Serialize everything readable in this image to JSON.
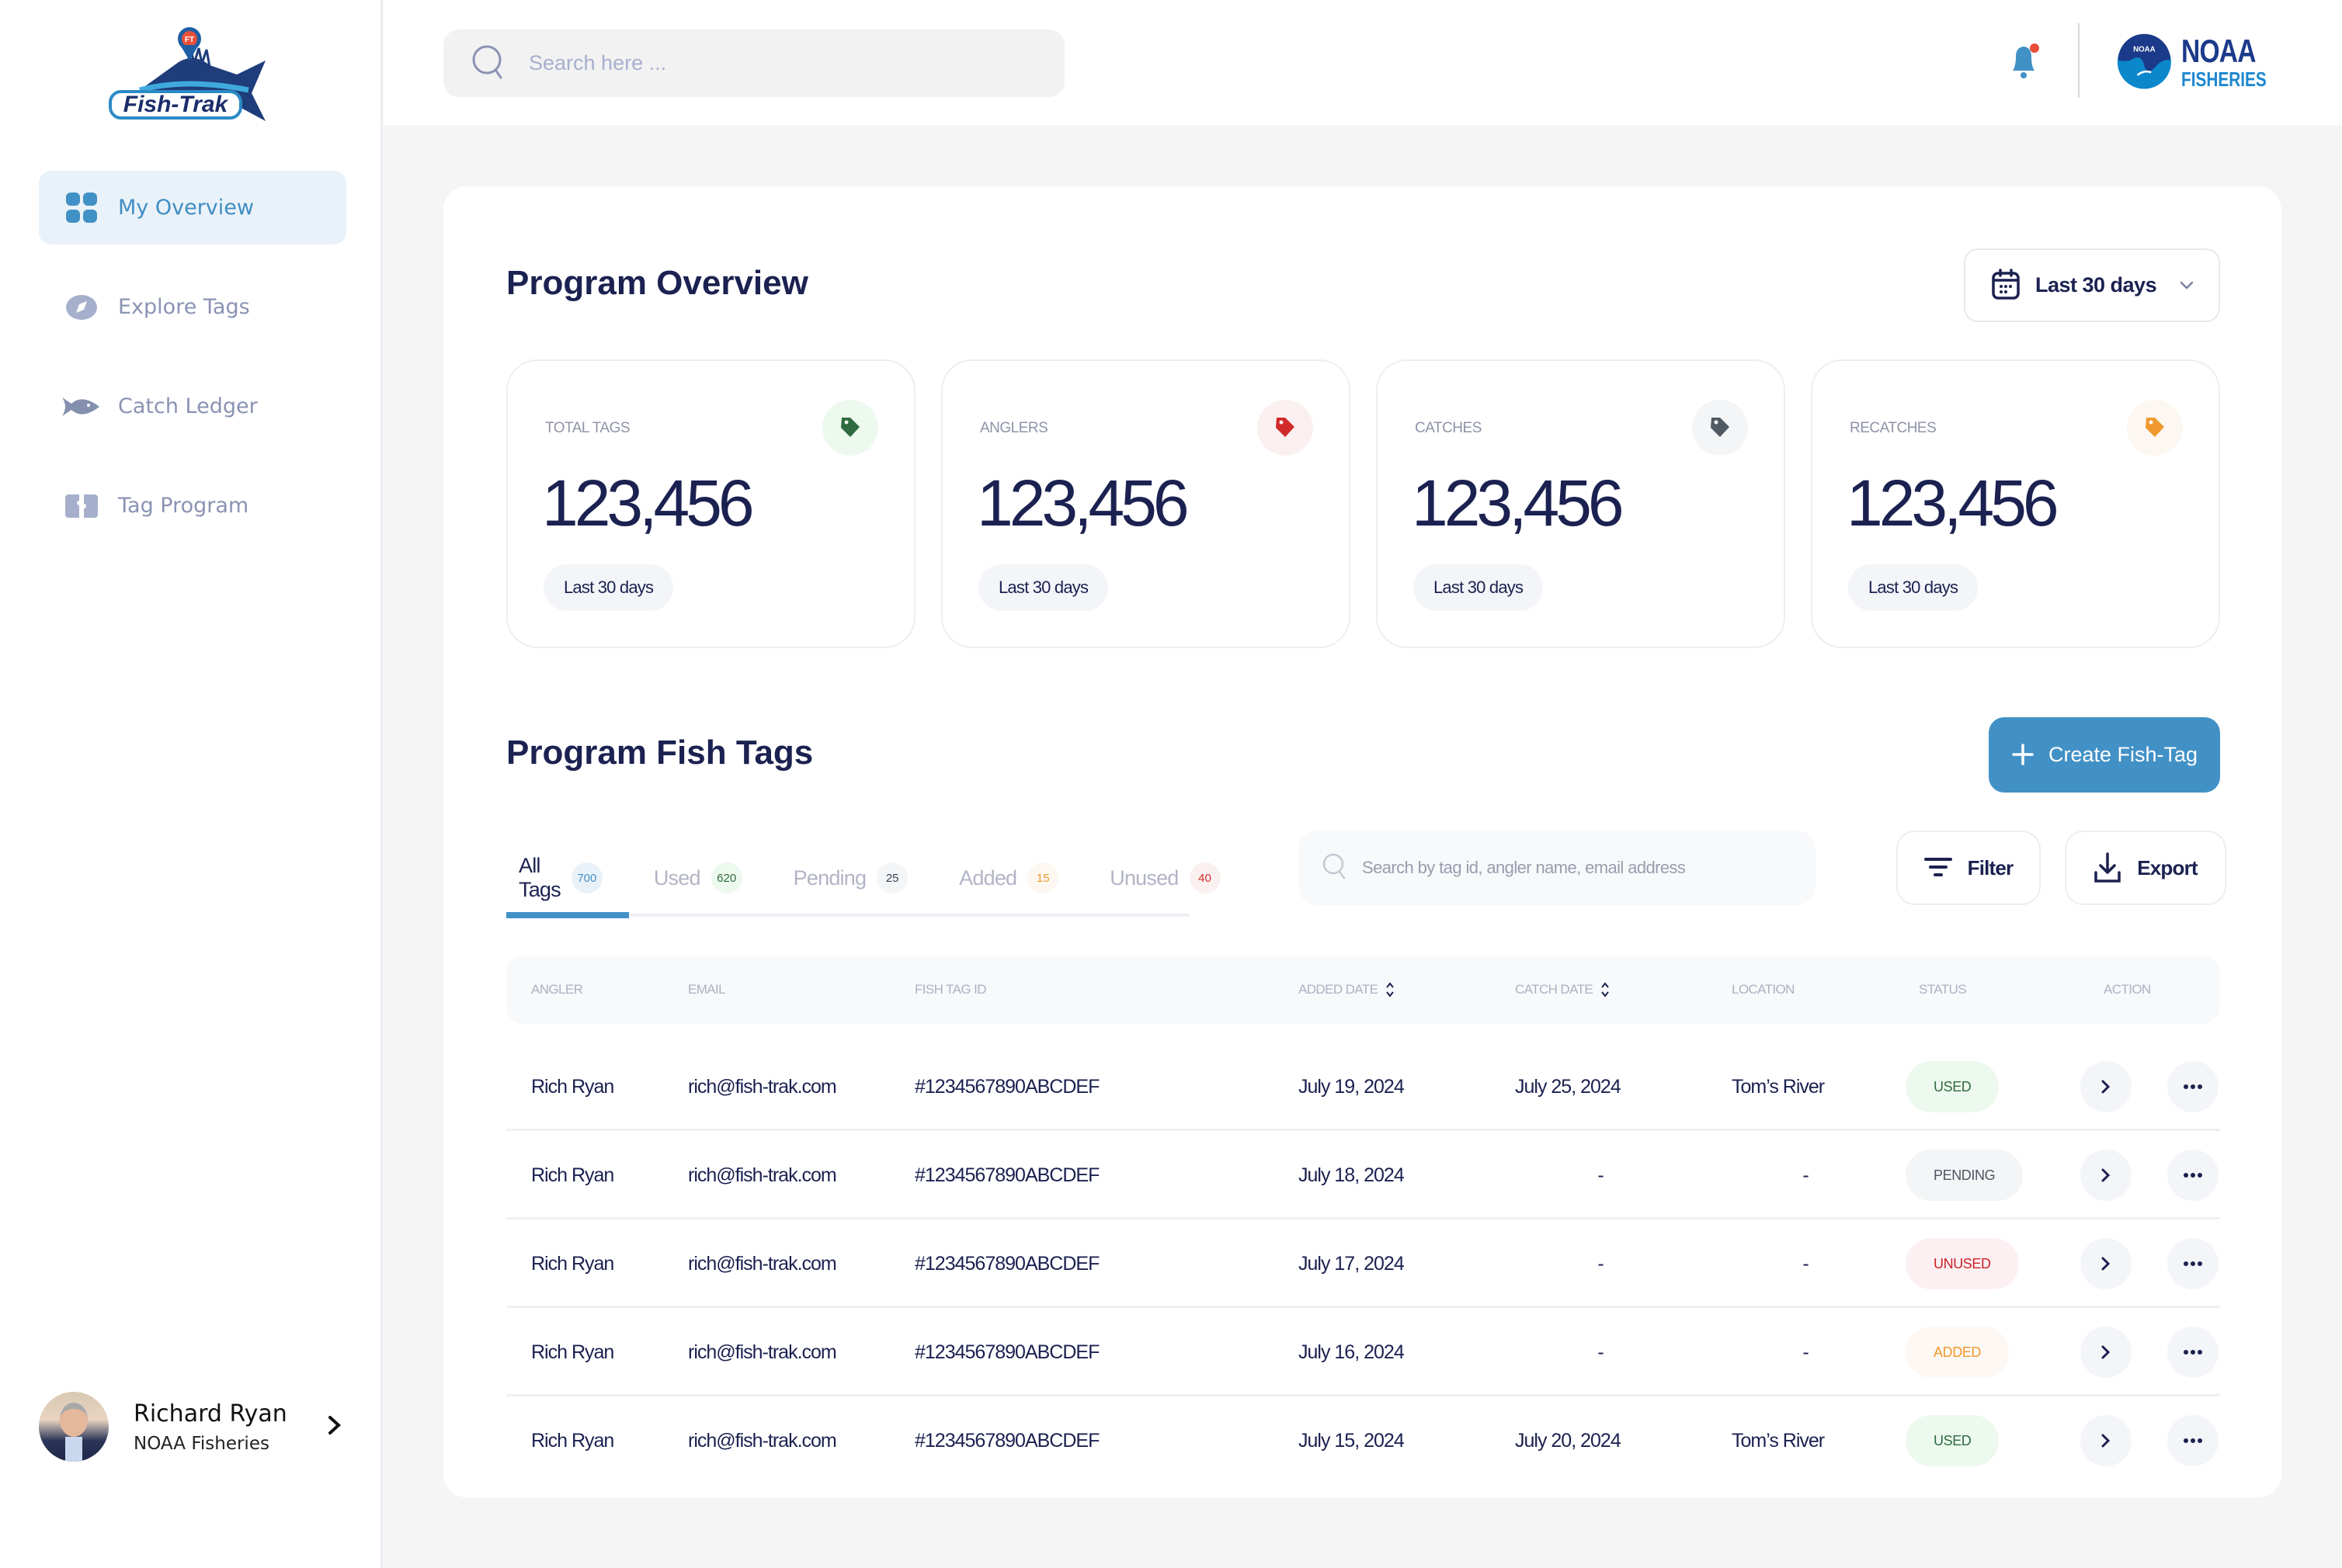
{
  "app": {
    "brand": "Fish-Trak",
    "partner_logo": {
      "line1": "NOAA",
      "line2": "FISHERIES",
      "emblem": "NOAA"
    }
  },
  "sidebar": {
    "items": [
      {
        "label": "My Overview",
        "icon": "grid-icon",
        "active": true
      },
      {
        "label": "Explore Tags",
        "icon": "compass-icon",
        "active": false
      },
      {
        "label": "Catch Ledger",
        "icon": "fish-icon",
        "active": false
      },
      {
        "label": "Tag Program",
        "icon": "ticket-icon",
        "active": false
      }
    ],
    "profile": {
      "name": "Richard Ryan",
      "org": "NOAA Fisheries"
    }
  },
  "header": {
    "search_placeholder": "Search here ..."
  },
  "overview": {
    "title": "Program Overview",
    "date_range": "Last 30 days",
    "stats": [
      {
        "label": "TOTAL TAGS",
        "value": "123,456",
        "period": "Last 30 days",
        "color": "#2e6b3f",
        "bg": "#edf8ef"
      },
      {
        "label": "ANGLERS",
        "value": "123,456",
        "period": "Last 30 days",
        "color": "#d02a2a",
        "bg": "#fbf0f0"
      },
      {
        "label": "CATCHES",
        "value": "123,456",
        "period": "Last 30 days",
        "color": "#505a63",
        "bg": "#f4f5f7"
      },
      {
        "label": "RECATCHES",
        "value": "123,456",
        "period": "Last 30 days",
        "color": "#f0992e",
        "bg": "#fcf7f1"
      }
    ]
  },
  "tags_section": {
    "title": "Program Fish Tags",
    "create_label": "Create Fish-Tag",
    "search_placeholder": "Search by tag id, angler name, email address",
    "filter_label": "Filter",
    "export_label": "Export",
    "tabs": [
      {
        "label": "All Tags",
        "count": "700",
        "active": true,
        "color": "#4291c6",
        "bg": "#eaf2f9"
      },
      {
        "label": "Used",
        "count": "620",
        "active": false,
        "color": "#2e6b3f",
        "bg": "#edf8ef"
      },
      {
        "label": "Pending",
        "count": "25",
        "active": false,
        "color": "#3b4250",
        "bg": "#f4f5f7"
      },
      {
        "label": "Added",
        "count": "15",
        "active": false,
        "color": "#f0992e",
        "bg": "#fcf7f1"
      },
      {
        "label": "Unused",
        "count": "40",
        "active": false,
        "color": "#d02a2a",
        "bg": "#fbf0f0"
      }
    ],
    "columns": [
      "ANGLER",
      "EMAIL",
      "FISH TAG ID",
      "ADDED DATE",
      "CATCH DATE",
      "LOCATION",
      "STATUS",
      "ACTION"
    ],
    "rows": [
      {
        "angler": "Rich Ryan",
        "email": "rich@fish-trak.com",
        "tag_id": "#1234567890ABCDEF",
        "added": "July 19, 2024",
        "catch": "July 25, 2024",
        "location": "Tom’s River",
        "status": "USED"
      },
      {
        "angler": "Rich Ryan",
        "email": "rich@fish-trak.com",
        "tag_id": "#1234567890ABCDEF",
        "added": "July 18, 2024",
        "catch": "-",
        "location": "-",
        "status": "PENDING"
      },
      {
        "angler": "Rich Ryan",
        "email": "rich@fish-trak.com",
        "tag_id": "#1234567890ABCDEF",
        "added": "July 17, 2024",
        "catch": "-",
        "location": "-",
        "status": "UNUSED"
      },
      {
        "angler": "Rich Ryan",
        "email": "rich@fish-trak.com",
        "tag_id": "#1234567890ABCDEF",
        "added": "July 16, 2024",
        "catch": "-",
        "location": "-",
        "status": "ADDED"
      },
      {
        "angler": "Rich Ryan",
        "email": "rich@fish-trak.com",
        "tag_id": "#1234567890ABCDEF",
        "added": "July 15, 2024",
        "catch": "July 20, 2024",
        "location": "Tom’s River",
        "status": "USED"
      }
    ],
    "status_colors": {
      "USED": {
        "fg": "#2e6b3f",
        "bg": "#edf8ef"
      },
      "PENDING": {
        "fg": "#4c5561",
        "bg": "#f4f5f7"
      },
      "UNUSED": {
        "fg": "#cc2229",
        "bg": "#fcf0f2"
      },
      "ADDED": {
        "fg": "#f0992e",
        "bg": "#fdf8f3"
      }
    }
  },
  "colors": {
    "accent": "#4291c6",
    "text": "#1b2150",
    "bell_dot": "#e8503a"
  }
}
